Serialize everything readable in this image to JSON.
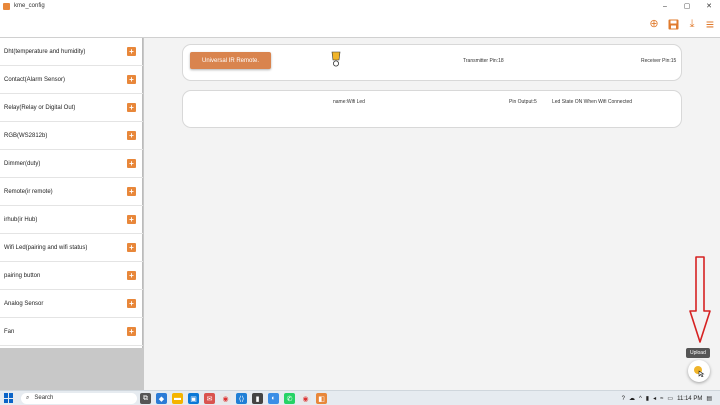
{
  "window": {
    "title": "kme_config",
    "minimize": "–",
    "maximize": "▢",
    "close": "✕"
  },
  "toolbar": {
    "add": "⊕",
    "save": "💾",
    "download": "⤓",
    "menu": "≡"
  },
  "sidebar": {
    "items": [
      {
        "label": "Dht(temperature and humidity)"
      },
      {
        "label": "Contact(Alarm Sensor)"
      },
      {
        "label": "Relay(Relay or Digital Out)"
      },
      {
        "label": "RGB(WS2812b)"
      },
      {
        "label": "Dimmer(duty)"
      },
      {
        "label": "Remote(ir remote)"
      },
      {
        "label": "irhub(ir Hub)"
      },
      {
        "label": "Wifi Led(pairing and wifi status)"
      },
      {
        "label": "pairing button"
      },
      {
        "label": "Analog Sensor"
      },
      {
        "label": "Fan"
      }
    ],
    "add_icon": "+"
  },
  "cards": {
    "ir": {
      "button": "Universal IR Remote.",
      "transmitter": "Transmitter Pin:18",
      "receiver": "Receiver Pin:15"
    },
    "wifi": {
      "name": "name:Wifi Led",
      "pin": "Pin Output:5",
      "state": "Led State ON When Wifi Connected"
    }
  },
  "upload": {
    "tooltip": "Upload",
    "icon": "upload-icon"
  },
  "taskbar": {
    "search": "Search",
    "time": "11:14 PM"
  },
  "colors": {
    "accent": "#e8873a",
    "button": "#d9844e",
    "arrow": "#d62222"
  }
}
